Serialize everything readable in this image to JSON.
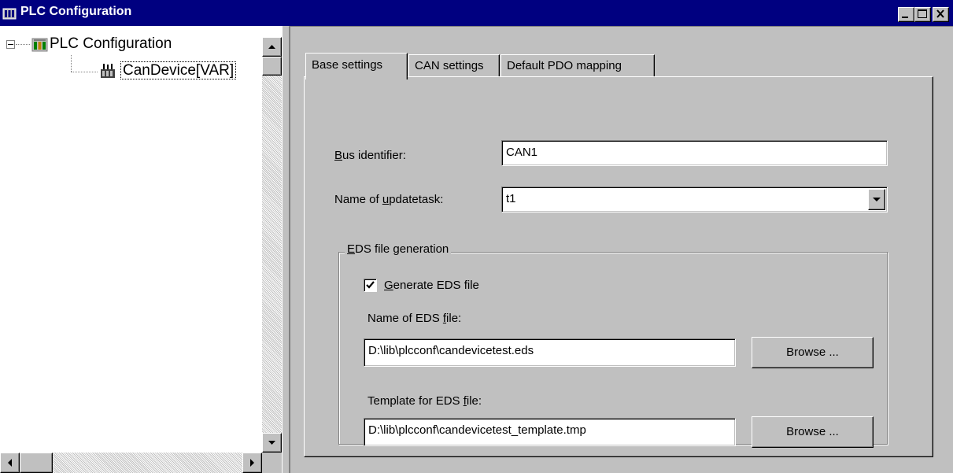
{
  "window": {
    "title": "PLC Configuration",
    "controls": {
      "minimize": "minimize-icon",
      "maximize": "maximize-icon",
      "close": "close-icon"
    }
  },
  "tree": {
    "root_label": "PLC Configuration",
    "child_label": "CanDevice[VAR]"
  },
  "tabs": [
    {
      "label": "Base settings"
    },
    {
      "label": "CAN settings"
    },
    {
      "label": "Default PDO mapping"
    }
  ],
  "base_settings": {
    "bus_identifier": {
      "label_key": "B",
      "label_rest": "us identifier:",
      "value": "CAN1"
    },
    "update_task": {
      "label_pre": "Name of ",
      "label_key": "u",
      "label_rest": "pdatetask:",
      "value": "t1"
    },
    "eds_group": {
      "title_key": "E",
      "title_rest": "DS file generation",
      "generate_checkbox": {
        "label_key": "G",
        "label_rest": "enerate EDS file",
        "checked": true
      },
      "eds_file": {
        "label_pre": "Name of EDS ",
        "label_key": "f",
        "label_rest": "ile:",
        "value": "D:\\lib\\plcconf\\candevicetest.eds",
        "browse_label": "Browse ..."
      },
      "template_file": {
        "label_pre": "Template for EDS ",
        "label_key": "f",
        "label_rest": "ile:",
        "value": "D:\\lib\\plcconf\\candevicetest_template.tmp",
        "browse_label": "Browse ..."
      }
    }
  },
  "colors": {
    "titlebar": "#000080",
    "face": "#c0c0c0"
  }
}
